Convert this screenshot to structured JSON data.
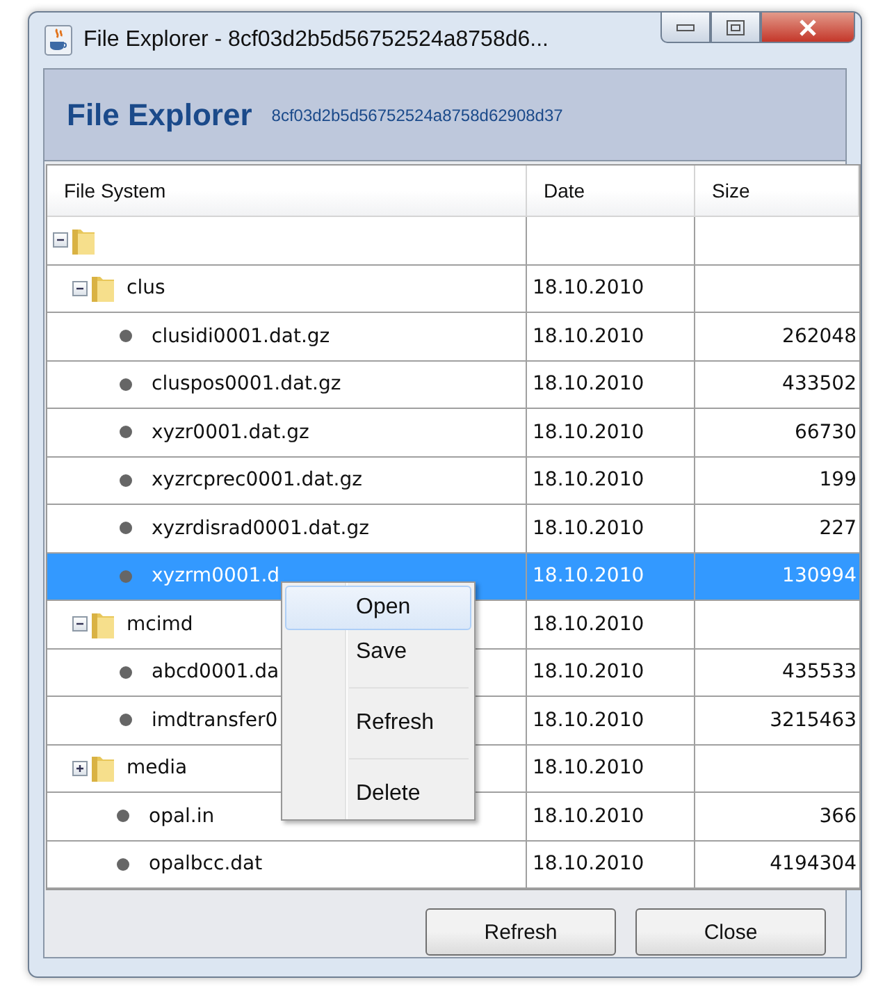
{
  "window": {
    "title": "File Explorer - 8cf03d2b5d56752524a8758d6..."
  },
  "header": {
    "title": "File Explorer",
    "subtitle": "8cf03d2b5d56752524a8758d62908d37"
  },
  "table": {
    "columns": [
      "File System",
      "Date",
      "Size"
    ],
    "tree": [
      {
        "kind": "folder",
        "expanded": true,
        "selected": false,
        "children": [
          {
            "kind": "folder",
            "name": "clus",
            "date": "18.10.2010",
            "expanded": true,
            "selected": false,
            "children": [
              {
                "kind": "file",
                "name": "clusidi0001.dat.gz",
                "date": "18.10.2010",
                "size": "262048",
                "selected": false
              },
              {
                "kind": "file",
                "name": "cluspos0001.dat.gz",
                "date": "18.10.2010",
                "size": "433502",
                "selected": false
              },
              {
                "kind": "file",
                "name": "xyzr0001.dat.gz",
                "date": "18.10.2010",
                "size": "66730",
                "selected": false
              },
              {
                "kind": "file",
                "name": "xyzrcprec0001.dat.gz",
                "date": "18.10.2010",
                "size": "199",
                "selected": false
              },
              {
                "kind": "file",
                "name": "xyzrdisrad0001.dat.gz",
                "date": "18.10.2010",
                "size": "227",
                "selected": false
              },
              {
                "kind": "file",
                "name": "xyzrm0001.d",
                "date": "18.10.2010",
                "size": "130994",
                "selected": true
              }
            ]
          },
          {
            "kind": "folder",
            "name": "mcimd",
            "date": "18.10.2010",
            "expanded": true,
            "selected": false,
            "children": [
              {
                "kind": "file",
                "name": "abcd0001.da",
                "date": "18.10.2010",
                "size": "435533",
                "selected": false
              },
              {
                "kind": "file",
                "name": "imdtransfer0",
                "date": "18.10.2010",
                "size": "3215463",
                "selected": false
              }
            ]
          },
          {
            "kind": "folder",
            "name": "media",
            "date": "18.10.2010",
            "expanded": false,
            "selected": false
          },
          {
            "kind": "file",
            "name": "opal.in",
            "date": "18.10.2010",
            "size": "366",
            "selected": false
          },
          {
            "kind": "file",
            "name": "opalbcc.dat",
            "date": "18.10.2010",
            "size": "4194304",
            "selected": false
          }
        ]
      }
    ]
  },
  "context_menu": {
    "groups": [
      [
        {
          "label": "Open",
          "selected": true
        },
        {
          "label": "Save",
          "selected": false
        }
      ],
      [
        {
          "label": "Refresh",
          "selected": false
        }
      ],
      [
        {
          "label": "Delete",
          "selected": false
        }
      ]
    ]
  },
  "buttons": [
    "Refresh",
    "Close"
  ]
}
